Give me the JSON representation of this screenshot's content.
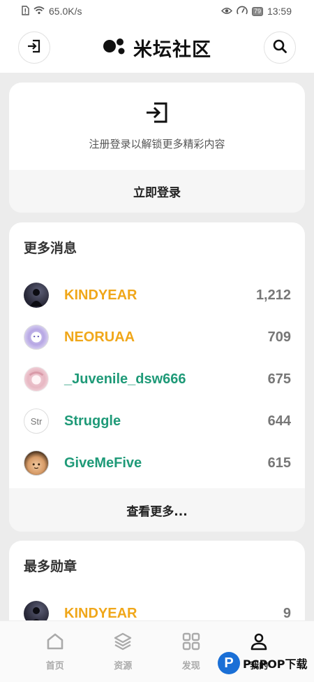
{
  "status_bar": {
    "net_speed": "65.0K/s",
    "battery": "79",
    "time": "13:59"
  },
  "header": {
    "title": "米坛社区",
    "left_icon": "login-icon",
    "right_icon": "search-icon"
  },
  "login_card": {
    "prompt": "注册登录以解锁更多精彩内容",
    "button_label": "立即登录"
  },
  "news_card": {
    "title": "更多消息",
    "rows": [
      {
        "name": "KINDYEAR",
        "count": "1,212",
        "color": "#f0a71a",
        "avatar_text": ""
      },
      {
        "name": "NEORUAA",
        "count": "709",
        "color": "#f0a71a",
        "avatar_text": ""
      },
      {
        "name": "_Juvenile_dsw666",
        "count": "675",
        "color": "#1f9a78",
        "avatar_text": ""
      },
      {
        "name": "Struggle",
        "count": "644",
        "color": "#1f9a78",
        "avatar_text": "Str"
      },
      {
        "name": "GiveMeFive",
        "count": "615",
        "color": "#1f9a78",
        "avatar_text": ""
      }
    ],
    "more_label": "查看更多..."
  },
  "medal_card": {
    "title": "最多勋章",
    "rows": [
      {
        "name": "KINDYEAR",
        "count": "9",
        "color": "#f0a71a"
      }
    ]
  },
  "bottom_nav": {
    "items": [
      {
        "label": "首页",
        "icon": "home-icon",
        "active": false
      },
      {
        "label": "资源",
        "icon": "layers-icon",
        "active": false
      },
      {
        "label": "发现",
        "icon": "grid-icon",
        "active": false
      },
      {
        "label": "我的",
        "icon": "user-icon",
        "active": true
      }
    ]
  },
  "watermark": {
    "letter": "P",
    "text": "PCPOP下载"
  }
}
